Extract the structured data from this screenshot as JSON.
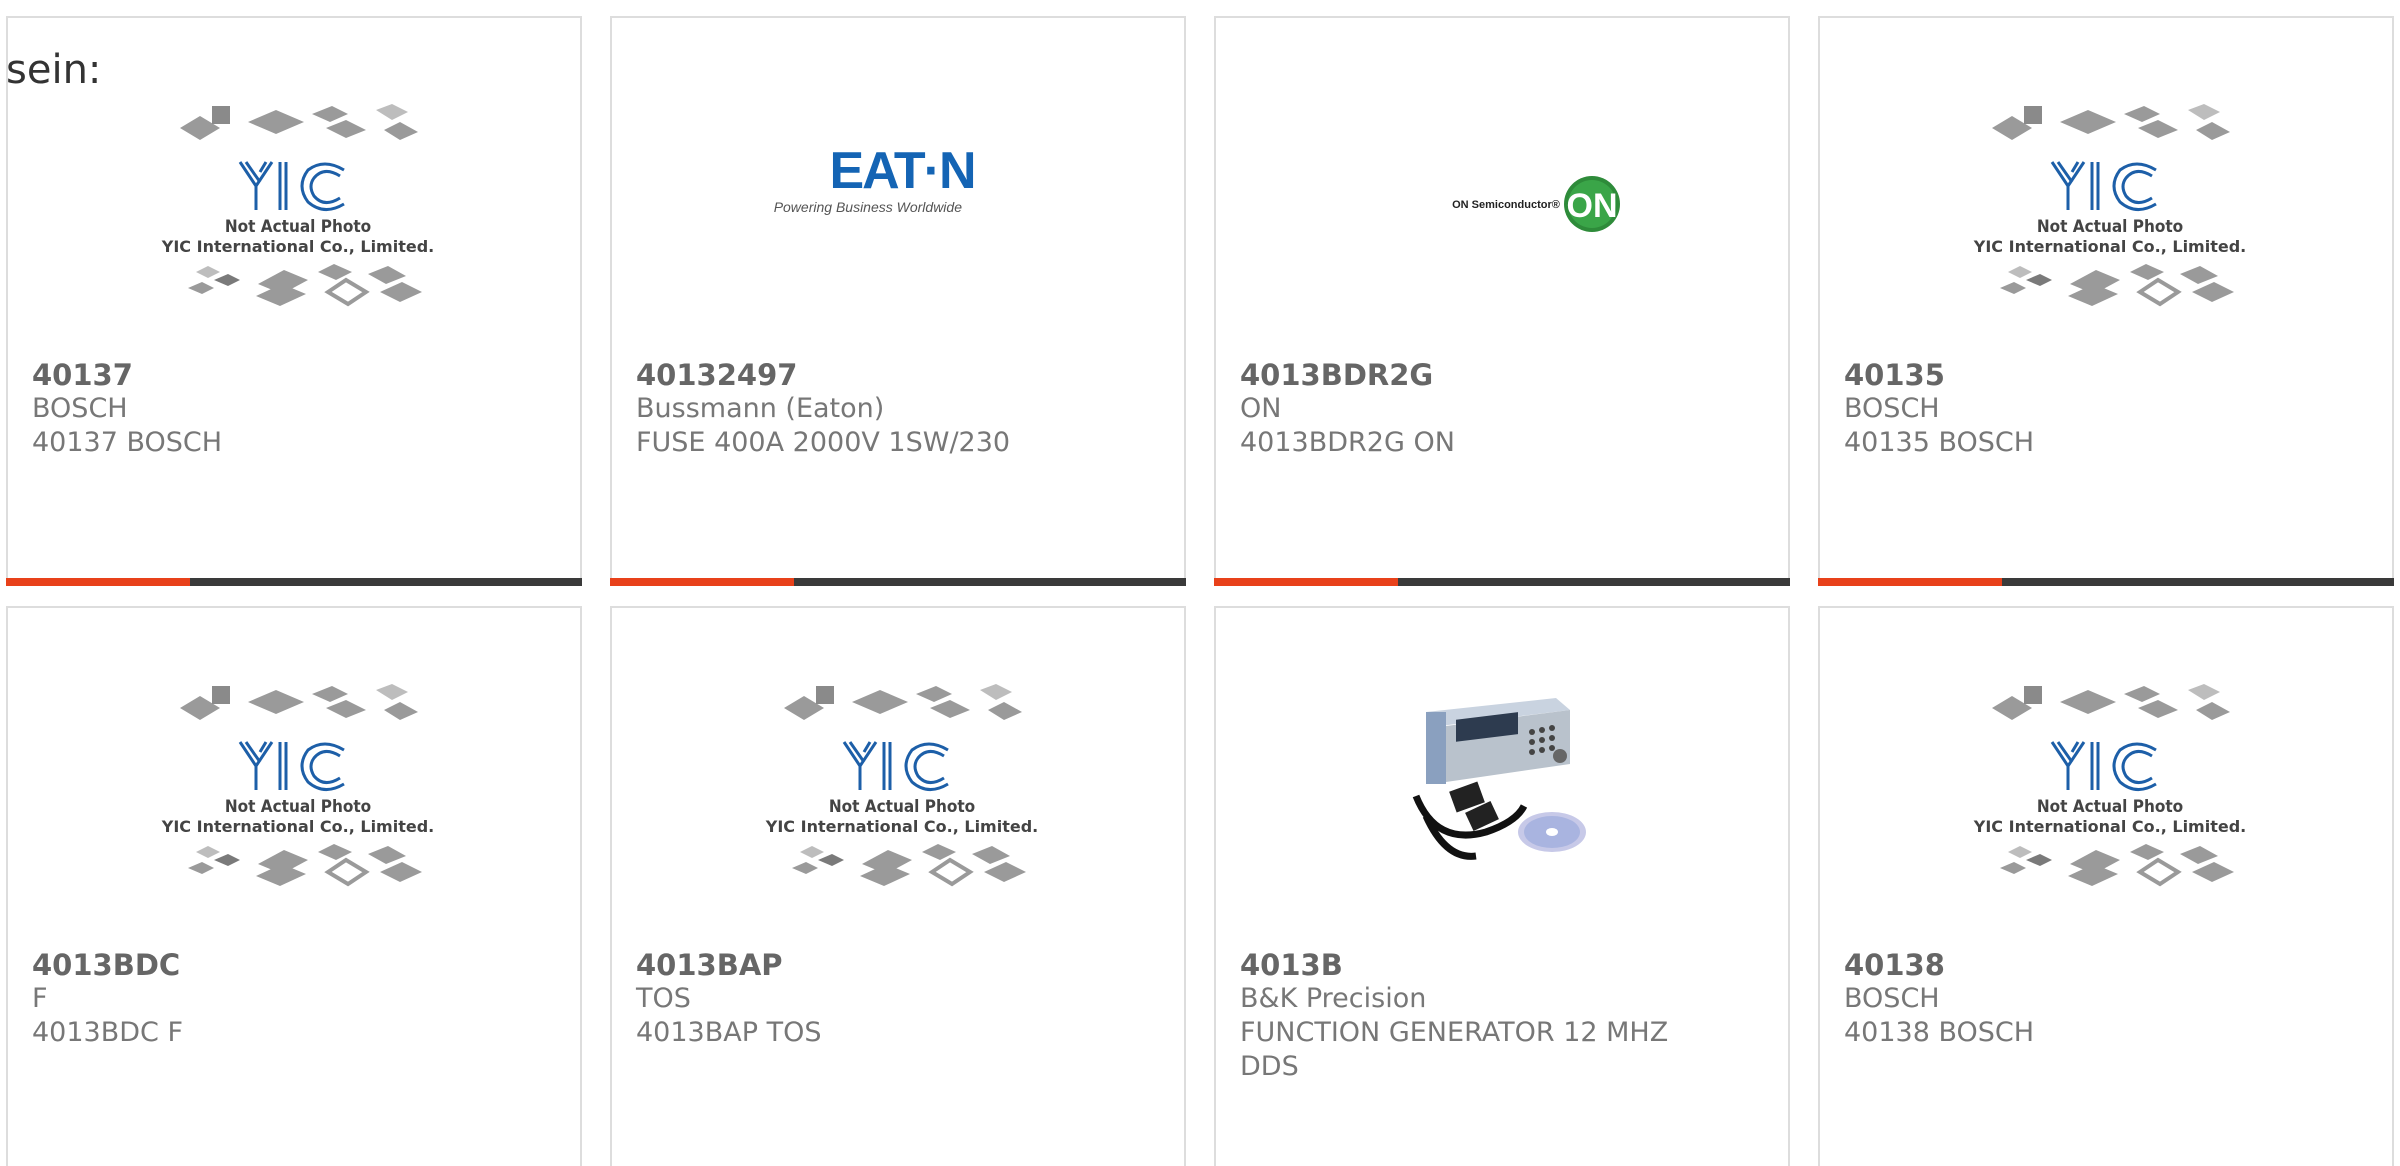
{
  "intro_text": "sein:",
  "placeholder": {
    "line1": "Not Actual Photo",
    "line2": "YIC International Co., Limited."
  },
  "brand": {
    "eaton": {
      "logo": "EAT·N",
      "tagline": "Powering Business Worldwide"
    },
    "onsemi": {
      "name": "ON Semiconductor®",
      "badge": "ON"
    }
  },
  "colors": {
    "accent": "#e8411a",
    "bar": "#3a3a3a",
    "border": "#dddddd",
    "text": "#666666",
    "eaton": "#1464b4",
    "onsemi": "#2e8b3a"
  },
  "products": [
    {
      "part": "40137",
      "maker": "BOSCH",
      "desc": "40137 BOSCH",
      "image": "yic-placeholder"
    },
    {
      "part": "40132497",
      "maker": "Bussmann (Eaton)",
      "desc": "FUSE 400A 2000V 1SW/230",
      "image": "eaton-logo"
    },
    {
      "part": "4013BDR2G",
      "maker": "ON",
      "desc": "4013BDR2G ON",
      "image": "onsemi-logo"
    },
    {
      "part": "40135",
      "maker": "BOSCH",
      "desc": "40135 BOSCH",
      "image": "yic-placeholder"
    },
    {
      "part": "4013BDC",
      "maker": "F",
      "desc": "4013BDC F",
      "image": "yic-placeholder"
    },
    {
      "part": "4013BAP",
      "maker": "TOS",
      "desc": "4013BAP TOS",
      "image": "yic-placeholder"
    },
    {
      "part": "4013B",
      "maker": "B&K Precision",
      "desc": "FUNCTION GENERATOR 12 MHZ",
      "desc2": "DDS",
      "image": "function-generator-photo"
    },
    {
      "part": "40138",
      "maker": "BOSCH",
      "desc": "40138 BOSCH",
      "image": "yic-placeholder"
    }
  ]
}
